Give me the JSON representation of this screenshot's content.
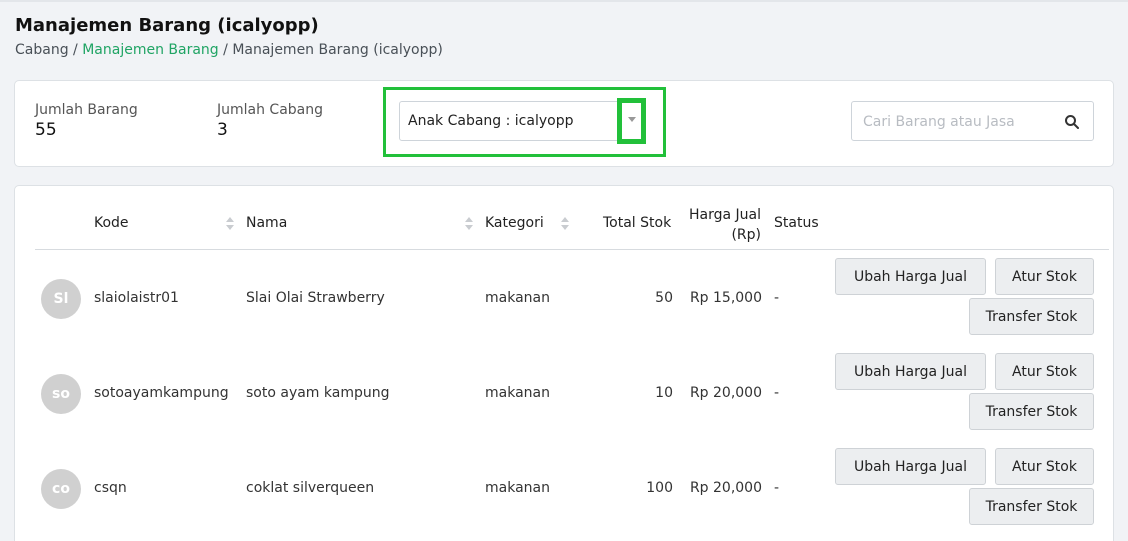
{
  "page": {
    "title": "Manajemen Barang (icalyopp)",
    "breadcrumb": [
      "Cabang",
      "Manajemen Barang",
      "Manajemen Barang (icalyopp)"
    ],
    "breadcrumb_sep": "/"
  },
  "summary": {
    "jumlah_barang_label": "Jumlah Barang",
    "jumlah_barang_value": "55",
    "jumlah_cabang_label": "Jumlah Cabang",
    "jumlah_cabang_value": "3",
    "anak_cabang_selected": "Anak Cabang : icalyopp",
    "search_placeholder": "Cari Barang atau Jasa",
    "search_value": ""
  },
  "table": {
    "columns": [
      "Kode",
      "Nama",
      "Kategori",
      "Total Stok",
      "Harga Jual",
      "(Rp)",
      "Status"
    ],
    "rows": [
      {
        "initials": "Sl",
        "kode": "slaiolaistr01",
        "nama": "Slai Olai Strawberry",
        "kategori": "makanan",
        "total_stok": "50",
        "harga_jual": "Rp 15,000",
        "status": "-"
      },
      {
        "initials": "so",
        "kode": "sotoayamkampung",
        "nama": "soto ayam kampung",
        "kategori": "makanan",
        "total_stok": "10",
        "harga_jual": "Rp 20,000",
        "status": "-"
      },
      {
        "initials": "co",
        "kode": "csqn",
        "nama": "coklat silverqueen",
        "kategori": "makanan",
        "total_stok": "100",
        "harga_jual": "Rp 20,000",
        "status": "-"
      }
    ],
    "actions": {
      "ubah_harga": "Ubah Harga Jual",
      "atur_stok": "Atur Stok",
      "transfer_stok": "Transfer Stok"
    }
  },
  "colors": {
    "accent": "#20a464",
    "highlight": "#22c03a",
    "avatar": "#d0d0d0"
  }
}
